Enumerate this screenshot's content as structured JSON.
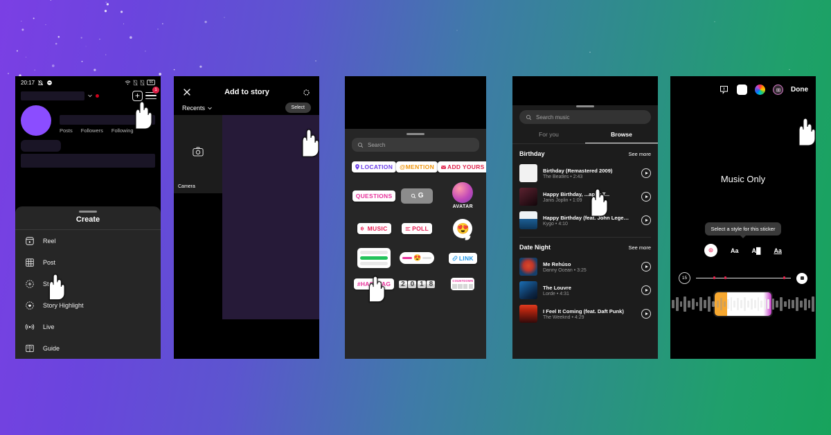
{
  "background": {
    "gradient_from": "#7b3fe4",
    "gradient_to": "#17a35c"
  },
  "panel1": {
    "name": "instagram-profile-create-menu",
    "statusbar": {
      "time": "20:17",
      "mute_icon": "bell-off-icon",
      "dnd_icon": "dnd-icon",
      "wifi_icon": "wifi-icon",
      "sim1_icon": "sim-off-icon",
      "sim2_icon": "sim-off-icon",
      "battery": "56"
    },
    "header": {
      "plus_icon": "plus-square-icon",
      "menu_icon": "hamburger-icon",
      "badge": "1",
      "chevron_icon": "chevron-down-icon"
    },
    "stats": [
      "Posts",
      "Followers",
      "Following"
    ],
    "sheet": {
      "title": "Create",
      "items": [
        {
          "label": "Reel",
          "icon": "reel-icon"
        },
        {
          "label": "Post",
          "icon": "grid-icon"
        },
        {
          "label": "Story",
          "icon": "plus-circle-icon"
        },
        {
          "label": "Story Highlight",
          "icon": "heart-circle-icon"
        },
        {
          "label": "Live",
          "icon": "broadcast-icon"
        },
        {
          "label": "Guide",
          "icon": "book-icon"
        }
      ]
    }
  },
  "panel2": {
    "name": "add-to-story-gallery",
    "close_icon": "close-icon",
    "title": "Add to story",
    "settings_icon": "gear-icon",
    "album": "Recents",
    "album_chevron": "chevron-down-icon",
    "select_label": "Select",
    "camera_label": "Camera",
    "camera_icon": "camera-icon"
  },
  "panel3": {
    "name": "story-sticker-tray",
    "search_placeholder": "Search",
    "search_icon": "search-icon",
    "stickers": [
      {
        "label": "LOCATION",
        "type": "pill",
        "color": "#6a3de8",
        "icon": "location-pin-icon"
      },
      {
        "label": "@MENTION",
        "type": "pill",
        "color": "#f0950c",
        "icon": "at-icon"
      },
      {
        "label": "ADD YOURS",
        "type": "pill",
        "color": "#e0224a",
        "icon": "add-yours-icon"
      },
      {
        "label": "QUESTIONS",
        "type": "pill",
        "color": "#e8309a",
        "icon": "questions-icon"
      },
      {
        "label": "G",
        "type": "gsearch",
        "color": "#ffffff",
        "icon": "google-search-icon"
      },
      {
        "label": "AVATAR",
        "type": "avatar",
        "color": "#c24ab8",
        "icon": "avatar-icon"
      },
      {
        "label": "MUSIC",
        "type": "pill",
        "color": "#e8184f",
        "icon": "music-icon"
      },
      {
        "label": "POLL",
        "type": "pill",
        "color": "#e8184f",
        "icon": "poll-icon"
      },
      {
        "label": "😍",
        "type": "emoji",
        "color": "#ffffff",
        "icon": "emoji-reaction-icon"
      },
      {
        "label": "",
        "type": "quiz",
        "color": "#21c25a",
        "icon": "quiz-sticker-icon"
      },
      {
        "label": "",
        "type": "slider",
        "color": "#e8309a",
        "icon": "emoji-slider-icon"
      },
      {
        "label": "LINK",
        "type": "pill",
        "color": "#1b94e6",
        "icon": "link-icon"
      },
      {
        "label": "#HASHTAG",
        "type": "pill",
        "color": "#e8309a",
        "icon": "hashtag-icon"
      },
      {
        "label": "2018",
        "type": "flip",
        "color": "#3a3a3a",
        "icon": "countdown-digits-icon"
      },
      {
        "label": "COUNTDOWN",
        "type": "countdown",
        "color": "#e8309a",
        "icon": "countdown-icon"
      }
    ]
  },
  "panel4": {
    "name": "music-picker",
    "search_placeholder": "Search music",
    "search_icon": "search-icon",
    "tabs": [
      {
        "label": "For you",
        "active": false
      },
      {
        "label": "Browse",
        "active": true
      }
    ],
    "see_more": "See more",
    "sections": [
      {
        "title": "Birthday",
        "songs": [
          {
            "title": "Birthday (Remastered 2009)",
            "artist": "The Beatles",
            "duration": "2:43",
            "art": "#ffffff"
          },
          {
            "title": "Happy  Birthday, ...appy T...",
            "artist": "Janis Joplin",
            "duration": "1:09",
            "art": "#3a1f2a"
          },
          {
            "title": "Happy Birthday (feat. John Lege…",
            "artist": "Kygo",
            "duration": "4:10",
            "art": "#1f4f7a"
          }
        ]
      },
      {
        "title": "Date Night",
        "songs": [
          {
            "title": "Me Rehúso",
            "artist": "Danny Ocean",
            "duration": "3:25",
            "art": "#1b4a7a"
          },
          {
            "title": "The Louvre",
            "artist": "Lorde",
            "duration": "4:31",
            "art": "#153a66"
          },
          {
            "title": "I Feel It Coming (feat. Daft Punk)",
            "artist": "The Weeknd",
            "duration": "4:29",
            "art": "#6b1414"
          }
        ]
      }
    ]
  },
  "panel5": {
    "name": "music-sticker-editor",
    "toolbar": {
      "sticker_icon": "sticker-alert-icon",
      "text_icon": "text-box-icon",
      "color_icon": "color-wheel-icon",
      "effects_icon": "effects-icon",
      "done_label": "Done"
    },
    "title": "Music Only",
    "tooltip": "Select a style for this sticker",
    "styles": [
      {
        "label": "⊛",
        "selected": true,
        "name": "style-album"
      },
      {
        "label": "Aa",
        "selected": false,
        "name": "style-lyrics-large"
      },
      {
        "label": "A█",
        "selected": false,
        "name": "style-lyrics-block"
      },
      {
        "label": "Aa",
        "selected": false,
        "name": "style-lyrics-underline"
      }
    ],
    "duration": "15",
    "record_icon": "stop-record-icon"
  }
}
